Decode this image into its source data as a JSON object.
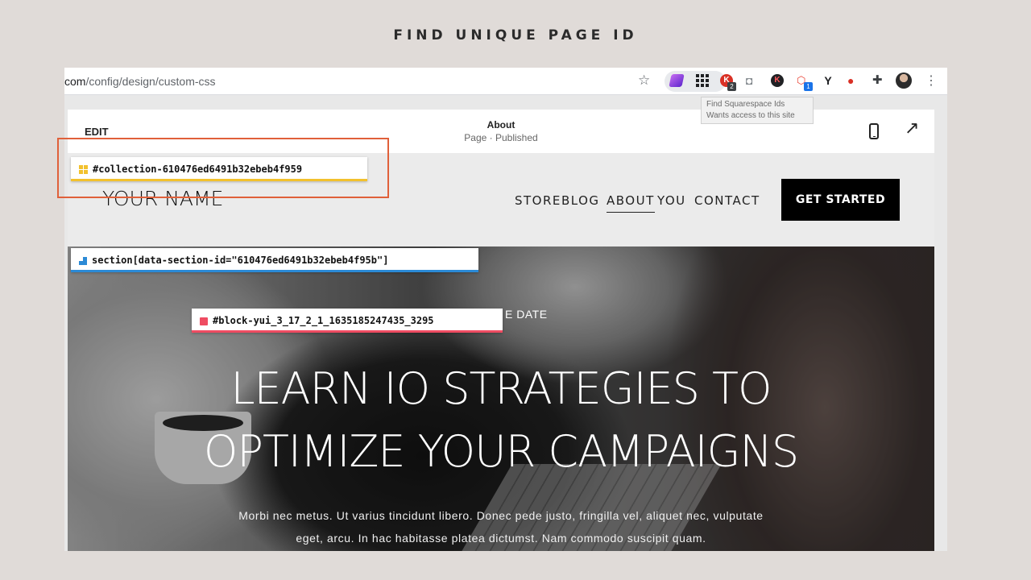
{
  "slide": {
    "title": "FIND UNIQUE PAGE ID"
  },
  "browser": {
    "url_host": "com",
    "url_path": "/config/design/custom-css",
    "extensions": [
      "pen-icon",
      "grid-icon",
      "k-icon",
      "camera-icon",
      "k-icon",
      "network-icon",
      "y-icon",
      "red-icon",
      "puzzle-icon"
    ],
    "badges": {
      "ext_k": "2",
      "ext_net": "1"
    },
    "tooltip": {
      "title": "Find Squarespace Ids",
      "subtitle": "Wants access to this site"
    }
  },
  "editor": {
    "edit_label": "EDIT",
    "page_title": "About",
    "page_status": "Page · Published"
  },
  "site": {
    "logo": "YOUR NAME",
    "nav": [
      {
        "label": "STORE",
        "active": false
      },
      {
        "label": "BLOG",
        "active": false
      },
      {
        "label": "ABOUT",
        "active": true
      },
      {
        "label": "YOU",
        "active": false
      },
      {
        "label": "CONTACT",
        "active": false
      }
    ],
    "cta": "GET STARTED",
    "hero": {
      "kicker": "E DATE",
      "heading_line1": "LEARN IO STRATEGIES TO",
      "heading_line2": "OPTIMIZE YOUR CAMPAIGNS",
      "body_line1": "Morbi nec metus. Ut varius tincidunt libero. Donec pede justo, fringilla vel, aliquet nec, vulputate",
      "body_line2": "eget, arcu. In hac habitasse platea dictumst. Nam commodo suscipit quam."
    }
  },
  "id_labels": {
    "collection": "#collection-610476ed6491b32ebeb4f959",
    "section": "section[data-section-id=\"610476ed6491b32ebeb4f95b\"]",
    "block": "#block-yui_3_17_2_1_1635185247435_3295"
  },
  "colors": {
    "highlight_border": "#e0603a",
    "collection_accent": "#f2c12e",
    "section_accent": "#2b8ad6",
    "block_accent": "#ef4c62",
    "background": "#e0dbd8"
  }
}
